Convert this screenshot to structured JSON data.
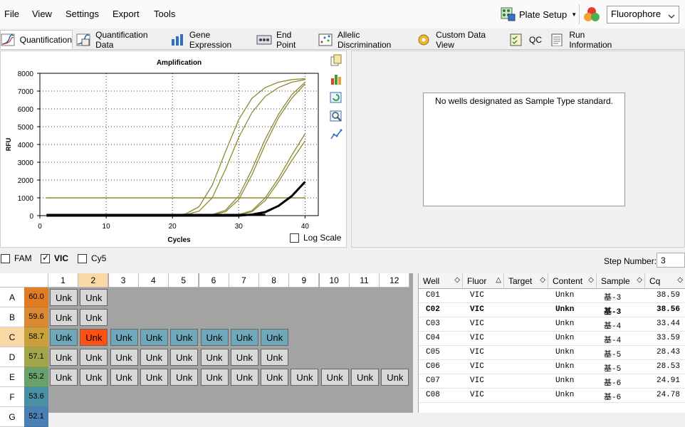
{
  "menu": {
    "file": "File",
    "view": "View",
    "settings": "Settings",
    "export": "Export",
    "tools": "Tools"
  },
  "toolbar": {
    "plate_setup": "Plate Setup",
    "fluorophore": "Fluorophore"
  },
  "tabs": [
    {
      "label": "Quantification",
      "icon": "amplification-icon"
    },
    {
      "label": "Quantification Data",
      "icon": "data-sheet-icon"
    },
    {
      "label": "Gene Expression",
      "icon": "bar-chart-icon"
    },
    {
      "label": "End Point",
      "icon": "endpoint-icon"
    },
    {
      "label": "Allelic Discrimination",
      "icon": "scatter-icon"
    },
    {
      "label": "Custom Data View",
      "icon": "gear-icon"
    },
    {
      "label": "QC",
      "icon": "checklist-icon"
    },
    {
      "label": "Run Information",
      "icon": "document-icon"
    }
  ],
  "chart_data": {
    "type": "line",
    "title": "Amplification",
    "xlabel": "Cycles",
    "ylabel": "RFU",
    "xlim": [
      0,
      42
    ],
    "ylim": [
      0,
      8000
    ],
    "xticks": [
      0,
      10,
      20,
      30,
      40
    ],
    "yticks": [
      0,
      1000,
      2000,
      3000,
      4000,
      5000,
      6000,
      7000,
      8000
    ],
    "grid": true,
    "threshold": 1000,
    "series": [
      {
        "values_x": [
          1,
          20,
          22,
          24,
          26,
          28,
          30,
          32,
          34,
          36,
          38,
          40
        ],
        "values_y": [
          0,
          0,
          100,
          500,
          1700,
          3600,
          5400,
          6600,
          7200,
          7500,
          7650,
          7700
        ]
      },
      {
        "values_x": [
          1,
          20,
          22,
          24,
          26,
          28,
          30,
          32,
          34,
          36,
          38,
          40
        ],
        "values_y": [
          0,
          0,
          50,
          250,
          1000,
          2600,
          4400,
          5800,
          6700,
          7200,
          7500,
          7650
        ]
      },
      {
        "values_x": [
          1,
          24,
          26,
          28,
          30,
          32,
          34,
          36,
          38,
          40
        ],
        "values_y": [
          0,
          0,
          60,
          300,
          1100,
          2600,
          4300,
          5700,
          6800,
          7500
        ]
      },
      {
        "values_x": [
          1,
          24,
          26,
          28,
          30,
          32,
          34,
          36,
          38,
          40
        ],
        "values_y": [
          0,
          0,
          40,
          220,
          900,
          2300,
          4000,
          5500,
          6600,
          7400
        ]
      },
      {
        "values_x": [
          1,
          28,
          30,
          32,
          34,
          36,
          38,
          40
        ],
        "values_y": [
          0,
          0,
          60,
          280,
          1000,
          2100,
          3400,
          4600
        ]
      },
      {
        "values_x": [
          1,
          28,
          30,
          32,
          34,
          36,
          38,
          40
        ],
        "values_y": [
          0,
          0,
          40,
          220,
          850,
          1900,
          3100,
          4200
        ]
      },
      {
        "values_x": [
          1,
          30,
          32,
          34,
          36,
          38,
          39,
          40
        ],
        "values_y": [
          0,
          0,
          60,
          200,
          550,
          1100,
          1500,
          1900
        ],
        "bold": true
      }
    ],
    "colors": {
      "line": "#8d8a33",
      "threshold": "#8d8a33",
      "bold": "#000000"
    }
  },
  "log_scale_label": "Log Scale",
  "std_message": "No wells designated as Sample Type standard.",
  "fluors": [
    {
      "label": "FAM",
      "checked": false
    },
    {
      "label": "VIC",
      "checked": true
    },
    {
      "label": "Cy5",
      "checked": false
    }
  ],
  "step": {
    "label": "Step Number:",
    "value": "3"
  },
  "plate": {
    "columns": [
      "1",
      "2",
      "3",
      "4",
      "5",
      "6",
      "7",
      "8",
      "9",
      "10",
      "11",
      "12"
    ],
    "rows": [
      {
        "label": "A",
        "temp": "60.0",
        "temp_color": "#e07d22",
        "wells": [
          "Unk",
          "Unk"
        ]
      },
      {
        "label": "B",
        "temp": "59.6",
        "temp_color": "#da8a32",
        "wells": [
          "Unk",
          "Unk"
        ]
      },
      {
        "label": "C",
        "temp": "58.7",
        "temp_color": "#c8a03c",
        "wells": [
          "Unk",
          "Unk",
          "Unk",
          "Unk",
          "Unk",
          "Unk",
          "Unk",
          "Unk"
        ]
      },
      {
        "label": "D",
        "temp": "57.1",
        "temp_color": "#a2a54a",
        "wells": [
          "Unk",
          "Unk",
          "Unk",
          "Unk",
          "Unk",
          "Unk",
          "Unk",
          "Unk"
        ]
      },
      {
        "label": "E",
        "temp": "55.2",
        "temp_color": "#6aa06a",
        "wells": [
          "Unk",
          "Unk",
          "Unk",
          "Unk",
          "Unk",
          "Unk",
          "Unk",
          "Unk",
          "Unk",
          "Unk",
          "Unk",
          "Unk"
        ]
      },
      {
        "label": "F",
        "temp": "53.6",
        "temp_color": "#4b8fa5",
        "wells": []
      },
      {
        "label": "G",
        "temp": "52.1",
        "temp_color": "#4a7fb3",
        "wells": []
      }
    ]
  },
  "results": {
    "columns": [
      "Well",
      "Fluor",
      "Target",
      "Content",
      "Sample",
      "Cq"
    ],
    "rows": [
      {
        "well": "C01",
        "fluor": "VIC",
        "target": "",
        "content": "Unkn",
        "sample": "基-3",
        "cq": "38.59"
      },
      {
        "well": "C02",
        "fluor": "VIC",
        "target": "",
        "content": "Unkn",
        "sample": "基-3",
        "cq": "38.56",
        "bold": true
      },
      {
        "well": "C03",
        "fluor": "VIC",
        "target": "",
        "content": "Unkn",
        "sample": "基-4",
        "cq": "33.44"
      },
      {
        "well": "C04",
        "fluor": "VIC",
        "target": "",
        "content": "Unkn",
        "sample": "基-4",
        "cq": "33.59"
      },
      {
        "well": "C05",
        "fluor": "VIC",
        "target": "",
        "content": "Unkn",
        "sample": "基-5",
        "cq": "28.43"
      },
      {
        "well": "C06",
        "fluor": "VIC",
        "target": "",
        "content": "Unkn",
        "sample": "基-5",
        "cq": "28.53"
      },
      {
        "well": "C07",
        "fluor": "VIC",
        "target": "",
        "content": "Unkn",
        "sample": "基-6",
        "cq": "24.91"
      },
      {
        "well": "C08",
        "fluor": "VIC",
        "target": "",
        "content": "Unkn",
        "sample": "基-6",
        "cq": "24.78"
      }
    ]
  }
}
